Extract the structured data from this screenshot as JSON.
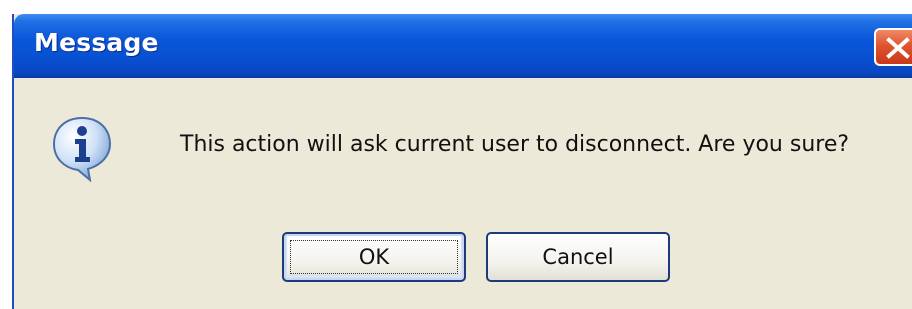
{
  "window": {
    "title": "Message",
    "close_icon": "close-icon"
  },
  "body": {
    "icon": "info-icon",
    "message": "This action will ask current user to disconnect. Are you sure?"
  },
  "buttons": {
    "ok_label": "OK",
    "cancel_label": "Cancel"
  },
  "colors": {
    "titlebar": "#0a56d8",
    "dialog_bg": "#ece9d8",
    "close_button": "#e0552e",
    "button_border": "#1d3b7a"
  }
}
